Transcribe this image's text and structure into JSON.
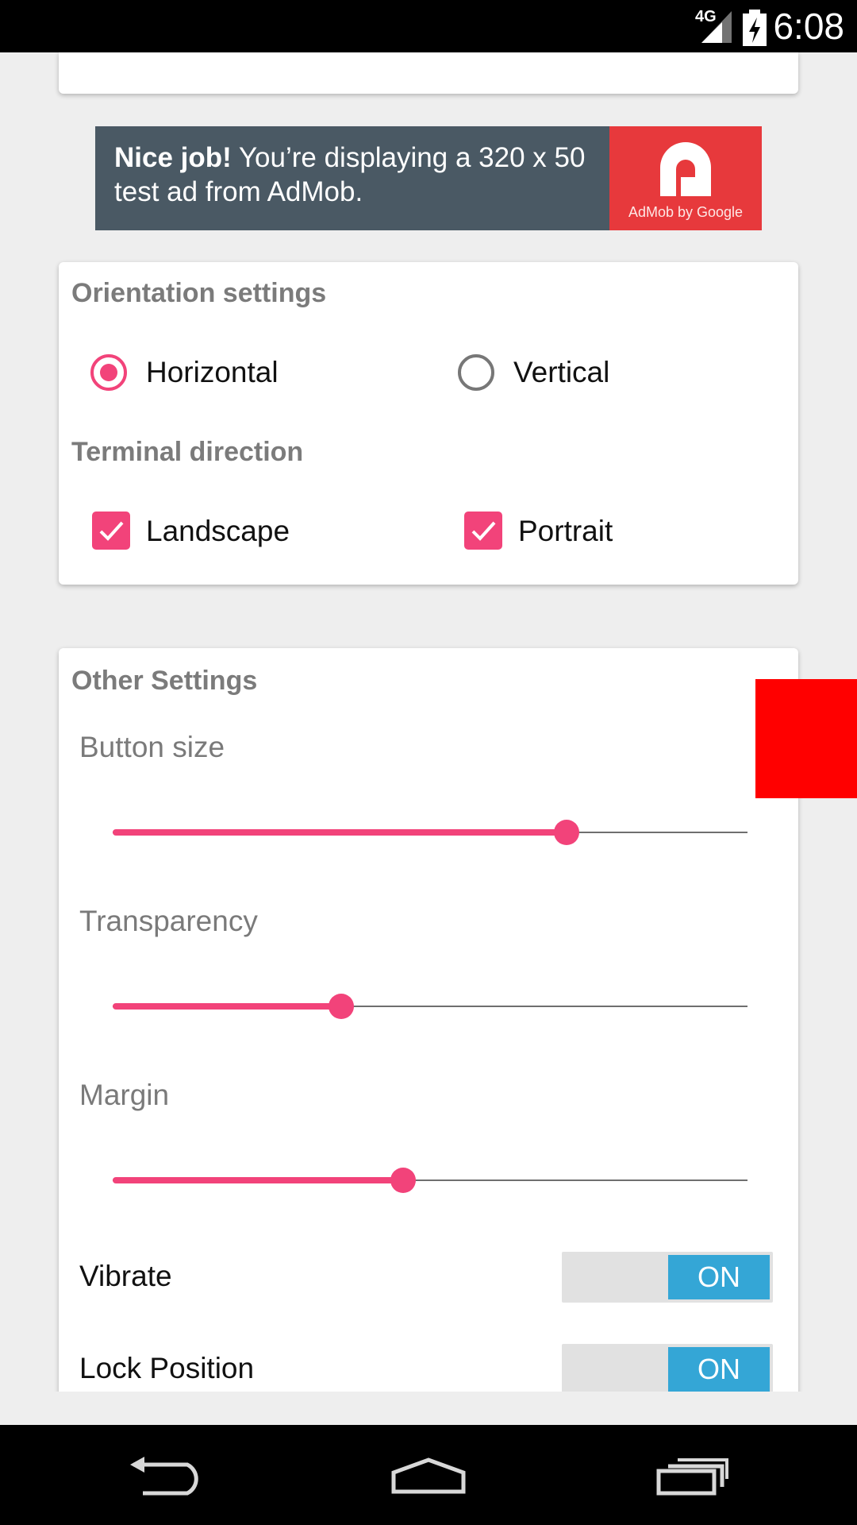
{
  "status_bar": {
    "network_label": "4G",
    "time": "6:08"
  },
  "ad": {
    "headline": "Nice job!",
    "body": " You’re displaying a 320 x 50 test ad from AdMob.",
    "logo_caption": "AdMob by Google"
  },
  "orientation": {
    "title": "Orientation settings",
    "options": [
      {
        "label": "Horizontal",
        "selected": true
      },
      {
        "label": "Vertical",
        "selected": false
      }
    ]
  },
  "terminal": {
    "title": "Terminal direction",
    "options": [
      {
        "label": "Landscape",
        "checked": true
      },
      {
        "label": "Portrait",
        "checked": true
      }
    ]
  },
  "other": {
    "title": "Other Settings",
    "sliders": [
      {
        "label": "Button size",
        "value_fraction": 0.72
      },
      {
        "label": "Transparency",
        "value_fraction": 0.36
      },
      {
        "label": "Margin",
        "value_fraction": 0.46
      }
    ],
    "toggles": [
      {
        "label": "Vibrate",
        "state": "ON"
      },
      {
        "label": "Lock Position",
        "state": "ON"
      }
    ]
  },
  "colors": {
    "accent": "#f2437a",
    "toggle_on": "#34a6d6",
    "overlay_red": "#ff0000",
    "ad_bg": "#4a5964",
    "ad_logo_bg": "#e7393c"
  },
  "icons": [
    "signal-icon",
    "battery-charging-icon",
    "back-icon",
    "home-icon",
    "recents-icon",
    "check-icon",
    "admob-logo-icon"
  ]
}
